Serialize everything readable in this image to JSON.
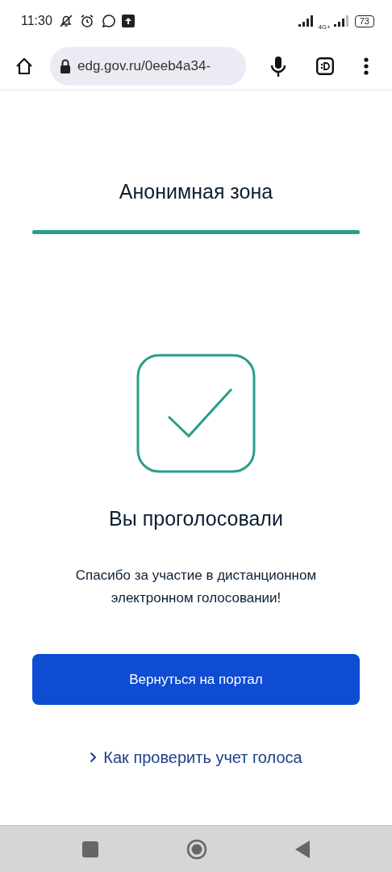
{
  "status_bar": {
    "time": "11:30",
    "network": "4G+",
    "battery": "73"
  },
  "browser": {
    "url": "edg.gov.ru/0eeb4a34-"
  },
  "page": {
    "title": "Анонимная зона",
    "progress": {
      "level": 1
    },
    "heading": "Вы проголосовали",
    "message": "Спасибо за участие в дистанционном электронном голосовании!",
    "button": "Вернуться на портал",
    "links": [
      "Как проверить учет голоса"
    ]
  }
}
